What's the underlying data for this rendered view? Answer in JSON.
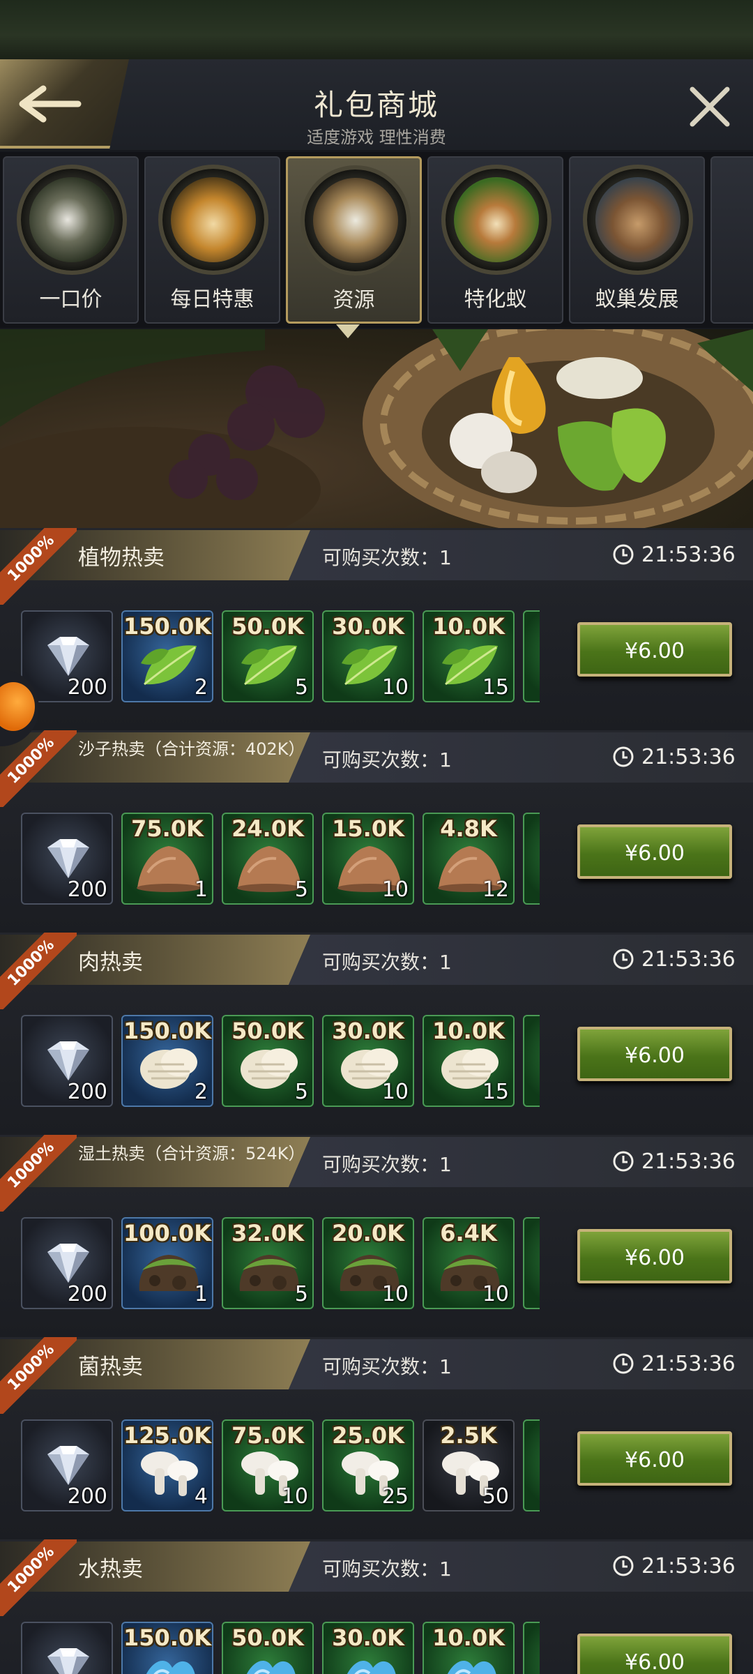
{
  "header": {
    "title": "礼包商城",
    "subtitle": "适度游戏 理性消费"
  },
  "tabs": [
    {
      "label": "一口价",
      "icon": "ants-icon"
    },
    {
      "label": "每日特惠",
      "icon": "honey-basket-icon"
    },
    {
      "label": "资源",
      "icon": "nest-resources-icon",
      "active": true
    },
    {
      "label": "特化蚁",
      "icon": "red-ant-icon"
    },
    {
      "label": "蚁巢发展",
      "icon": "dna-nest-icon"
    }
  ],
  "offers": [
    {
      "name": "植物热卖",
      "small": false,
      "ribbon": "1000%",
      "limit": "可购买次数：1",
      "timer": "21:53:36",
      "price": "¥6.00",
      "items": [
        {
          "kind": "diamond",
          "bg": "dia",
          "amount": "",
          "count": "200"
        },
        {
          "kind": "leaf",
          "bg": "blue",
          "amount": "150.0K",
          "count": "2"
        },
        {
          "kind": "leaf",
          "bg": "green",
          "amount": "50.0K",
          "count": "5"
        },
        {
          "kind": "leaf",
          "bg": "green",
          "amount": "30.0K",
          "count": "10"
        },
        {
          "kind": "leaf",
          "bg": "green",
          "amount": "10.0K",
          "count": "15"
        }
      ]
    },
    {
      "name": "沙子热卖（合计资源：402K）",
      "small": true,
      "ribbon": "1000%",
      "limit": "可购买次数：1",
      "timer": "21:53:36",
      "price": "¥6.00",
      "items": [
        {
          "kind": "diamond",
          "bg": "dia",
          "amount": "",
          "count": "200"
        },
        {
          "kind": "sand",
          "bg": "green",
          "amount": "75.0K",
          "count": "1"
        },
        {
          "kind": "sand",
          "bg": "green",
          "amount": "24.0K",
          "count": "5"
        },
        {
          "kind": "sand",
          "bg": "green",
          "amount": "15.0K",
          "count": "10"
        },
        {
          "kind": "sand",
          "bg": "green",
          "amount": "4.8K",
          "count": "12"
        }
      ]
    },
    {
      "name": "肉热卖",
      "small": false,
      "ribbon": "1000%",
      "limit": "可购买次数：1",
      "timer": "21:53:36",
      "price": "¥6.00",
      "items": [
        {
          "kind": "diamond",
          "bg": "dia",
          "amount": "",
          "count": "200"
        },
        {
          "kind": "meat",
          "bg": "blue",
          "amount": "150.0K",
          "count": "2"
        },
        {
          "kind": "meat",
          "bg": "green",
          "amount": "50.0K",
          "count": "5"
        },
        {
          "kind": "meat",
          "bg": "green",
          "amount": "30.0K",
          "count": "10"
        },
        {
          "kind": "meat",
          "bg": "green",
          "amount": "10.0K",
          "count": "15"
        }
      ]
    },
    {
      "name": "湿土热卖（合计资源：524K）",
      "small": true,
      "ribbon": "1000%",
      "limit": "可购买次数：1",
      "timer": "21:53:36",
      "price": "¥6.00",
      "items": [
        {
          "kind": "diamond",
          "bg": "dia",
          "amount": "",
          "count": "200"
        },
        {
          "kind": "soil",
          "bg": "blue",
          "amount": "100.0K",
          "count": "1"
        },
        {
          "kind": "soil",
          "bg": "green",
          "amount": "32.0K",
          "count": "5"
        },
        {
          "kind": "soil",
          "bg": "green",
          "amount": "20.0K",
          "count": "10"
        },
        {
          "kind": "soil",
          "bg": "green",
          "amount": "6.4K",
          "count": "10"
        }
      ]
    },
    {
      "name": "菌热卖",
      "small": false,
      "ribbon": "1000%",
      "limit": "可购买次数：1",
      "timer": "21:53:36",
      "price": "¥6.00",
      "items": [
        {
          "kind": "diamond",
          "bg": "dia",
          "amount": "",
          "count": "200"
        },
        {
          "kind": "mushroom",
          "bg": "blue",
          "amount": "125.0K",
          "count": "4"
        },
        {
          "kind": "mushroom",
          "bg": "green",
          "amount": "75.0K",
          "count": "10"
        },
        {
          "kind": "mushroom",
          "bg": "green",
          "amount": "25.0K",
          "count": "25"
        },
        {
          "kind": "mushroom",
          "bg": "dark",
          "amount": "2.5K",
          "count": "50"
        }
      ]
    },
    {
      "name": "水热卖",
      "small": false,
      "ribbon": "1000%",
      "limit": "可购买次数：1",
      "timer": "21:53:36",
      "price": "¥6.00",
      "items": [
        {
          "kind": "diamond",
          "bg": "dia",
          "amount": "",
          "count": ""
        },
        {
          "kind": "water",
          "bg": "blue",
          "amount": "150.0K",
          "count": ""
        },
        {
          "kind": "water",
          "bg": "green",
          "amount": "50.0K",
          "count": ""
        },
        {
          "kind": "water",
          "bg": "green",
          "amount": "30.0K",
          "count": ""
        },
        {
          "kind": "water",
          "bg": "green",
          "amount": "10.0K",
          "count": ""
        }
      ]
    }
  ]
}
